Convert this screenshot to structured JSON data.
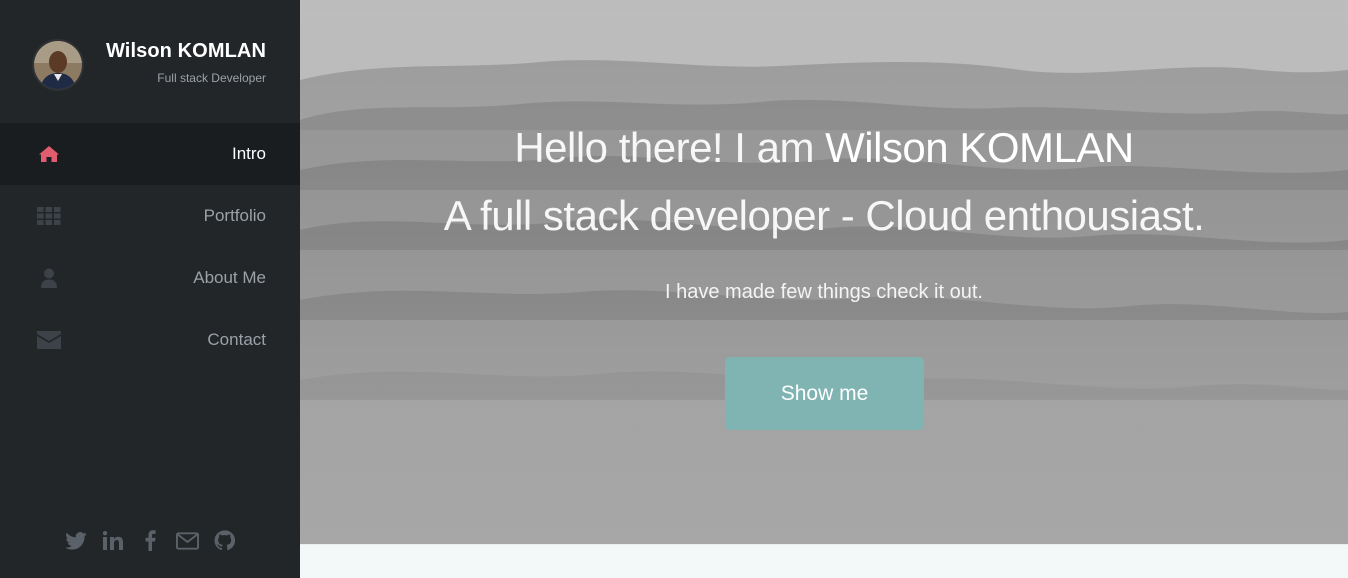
{
  "profile": {
    "name": "Wilson KOMLAN",
    "role": "Full stack Developer"
  },
  "nav": {
    "items": [
      {
        "label": "Intro",
        "icon": "home-icon",
        "active": true
      },
      {
        "label": "Portfolio",
        "icon": "grid-icon",
        "active": false
      },
      {
        "label": "About Me",
        "icon": "user-icon",
        "active": false
      },
      {
        "label": "Contact",
        "icon": "envelope-icon",
        "active": false
      }
    ]
  },
  "socials": [
    "twitter-icon",
    "linkedin-icon",
    "facebook-icon",
    "email-icon",
    "github-icon"
  ],
  "hero": {
    "greeting": "Hello there! I am ",
    "name": "Wilson KOMLAN",
    "tagline": "A full stack developer - Cloud enthousiast.",
    "subtitle": "I have made few things check it out.",
    "cta_label": "Show me"
  },
  "colors": {
    "sidebar_bg": "#222629",
    "active_bg": "#1a1d20",
    "accent_pink": "#e05d6f",
    "cta_bg": "#7fb4b3",
    "muted_icon": "#3c4248"
  }
}
